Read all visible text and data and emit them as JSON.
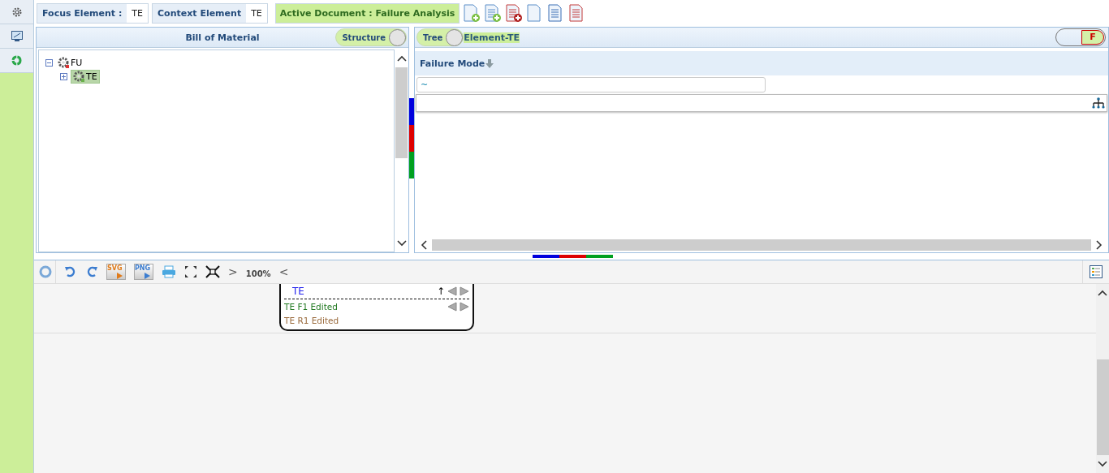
{
  "top_bar": {
    "focus_element": {
      "label": "Focus Element :",
      "value": "TE"
    },
    "context_element": {
      "label": "Context Element",
      "value": "TE"
    },
    "active_document": "Active Document : Failure Analysis"
  },
  "bom_panel": {
    "title": "Bill of Material",
    "toggle": {
      "label": "Structure",
      "on": true
    },
    "tree": [
      {
        "label": "FU",
        "expanded": true,
        "selected": false,
        "children": [
          {
            "label": "TE",
            "expanded": false,
            "selected": true
          }
        ]
      }
    ]
  },
  "failure_panel": {
    "toggle": {
      "label": "Tree",
      "on": true
    },
    "element_label": "Element-TE",
    "f_toggle": {
      "label": "F",
      "on": true
    },
    "column": "Failure Mode",
    "filter_value": "~"
  },
  "toolbar": {
    "svg_label": "SVG",
    "png_label": "PNG",
    "next": ">",
    "zoom": "100%",
    "prev": "<"
  },
  "diagram": {
    "node": {
      "title": "TE",
      "up": "↑",
      "rows": [
        {
          "text": "TE F1 Edited",
          "color": "#237a23"
        },
        {
          "text": "TE R1 Edited",
          "color": "#9a6a3c"
        }
      ]
    }
  }
}
